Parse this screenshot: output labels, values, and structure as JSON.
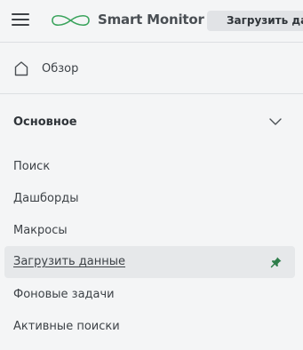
{
  "header": {
    "brand": "Smart Monitor",
    "upload_tab": "Загрузить данные",
    "menu_icon": "hamburger-icon",
    "logo_icon": "infinity-logo-icon",
    "accent": "#3aa35c"
  },
  "overview": {
    "label": "Обзор",
    "icon": "home-icon"
  },
  "section": {
    "title": "Основное",
    "icon": "chevron-down-icon",
    "items": [
      {
        "label": "Поиск"
      },
      {
        "label": "Дашборды"
      },
      {
        "label": "Макросы"
      },
      {
        "label": "Загрузить данные",
        "active": true,
        "pinned": true,
        "pin_color": "#2e7d4a"
      },
      {
        "label": "Фоновые задачи"
      },
      {
        "label": "Активные поиски"
      }
    ]
  }
}
